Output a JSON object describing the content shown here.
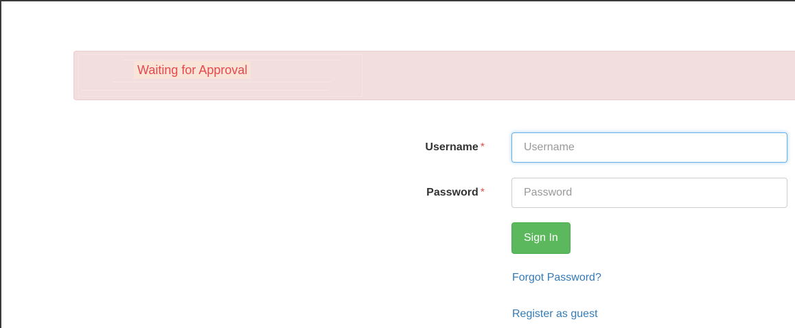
{
  "alert": {
    "message": "Waiting for Approval"
  },
  "form": {
    "username": {
      "label": "Username",
      "required_mark": "*",
      "placeholder": "Username",
      "value": ""
    },
    "password": {
      "label": "Password",
      "required_mark": "*",
      "placeholder": "Password",
      "value": ""
    },
    "sign_in_label": "Sign In",
    "forgot_password_label": "Forgot Password?",
    "register_guest_label": "Register as guest"
  },
  "colors": {
    "alert_background": "#f2dede",
    "alert_text": "#e8474b",
    "required_mark": "#d9534f",
    "primary_button": "#5cb85c",
    "link": "#337ab7",
    "focus_border": "#66afe9"
  }
}
